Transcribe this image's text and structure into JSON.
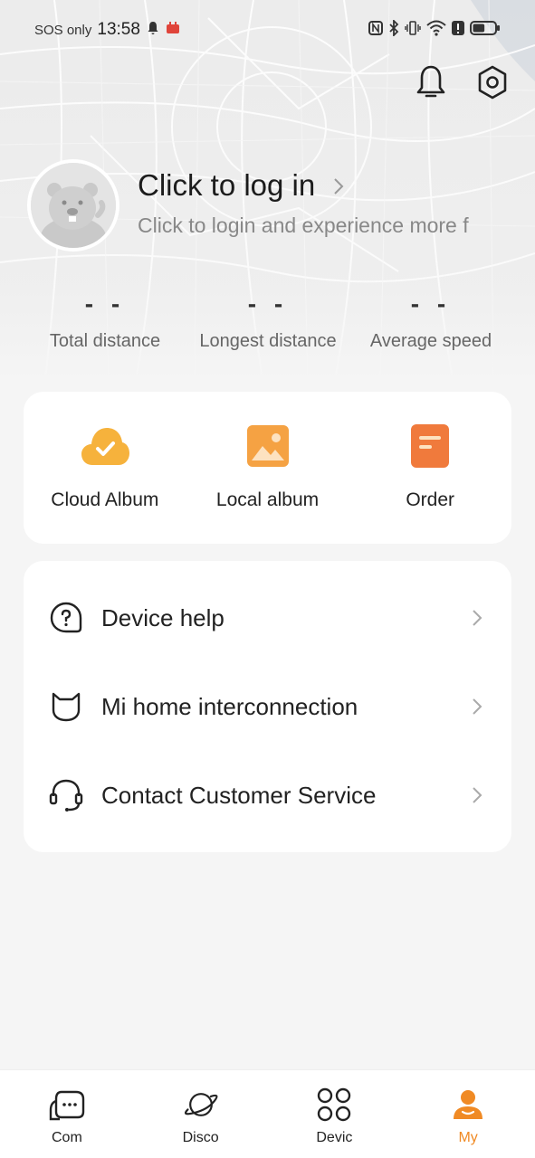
{
  "status_bar": {
    "carrier": "SOS only",
    "time": "13:58",
    "battery_level": 0.55,
    "icons": [
      "bell-icon",
      "app-notification-icon",
      "nfc-icon",
      "bluetooth-icon",
      "vibrate-icon",
      "wifi-icon",
      "alert-icon",
      "battery-icon"
    ]
  },
  "header": {
    "icons": [
      "notification-bell-icon",
      "settings-hexagon-icon"
    ]
  },
  "profile": {
    "title": "Click to log in",
    "subtitle": "Click to login and experience more f"
  },
  "stats": [
    {
      "value": "- -",
      "label": "Total distance"
    },
    {
      "value": "- -",
      "label": "Longest distance"
    },
    {
      "value": "- -",
      "label": "Average speed"
    }
  ],
  "quick_actions": [
    {
      "label": "Cloud Album",
      "icon": "cloud-check-icon"
    },
    {
      "label": "Local album",
      "icon": "image-icon"
    },
    {
      "label": "Order",
      "icon": "order-document-icon"
    }
  ],
  "menu": [
    {
      "label": "Device help",
      "icon": "question-bubble-icon"
    },
    {
      "label": "Mi home interconnection",
      "icon": "mi-home-icon"
    },
    {
      "label": "Contact Customer Service",
      "icon": "headset-icon"
    }
  ],
  "bottom_nav": [
    {
      "label": "Com",
      "icon": "community-chat-icon",
      "active": false
    },
    {
      "label": "Disco",
      "icon": "planet-icon",
      "active": false
    },
    {
      "label": "Devic",
      "icon": "devices-grid-icon",
      "active": false
    },
    {
      "label": "My",
      "icon": "person-icon",
      "active": true
    }
  ],
  "colors": {
    "accent": "#f08a24",
    "cloud_icon": "#f6b23c",
    "album_icon": "#f5a243",
    "order_icon": "#f07a3c",
    "background": "#f5f5f5"
  }
}
